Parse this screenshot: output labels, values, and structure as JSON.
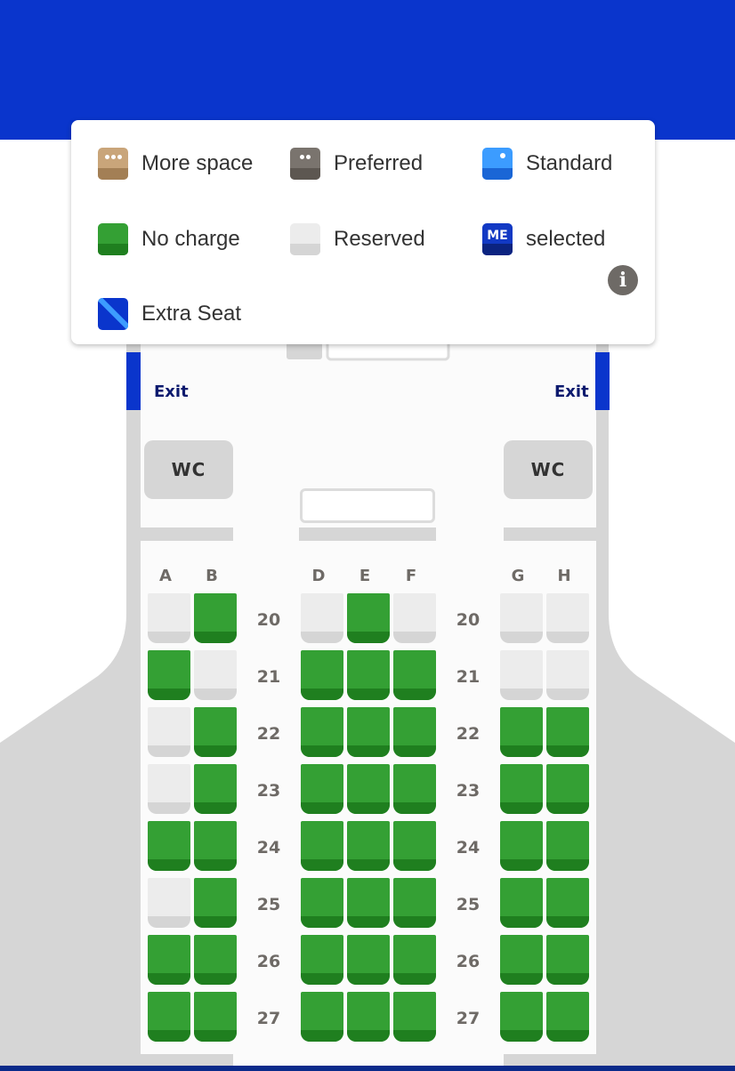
{
  "legend": {
    "more_space": "More space",
    "preferred": "Preferred",
    "standard": "Standard",
    "no_charge": "No charge",
    "reserved": "Reserved",
    "selected": "selected",
    "selected_badge": "ME",
    "extra_seat": "Extra Seat",
    "info_icon": "info-icon"
  },
  "cabin": {
    "exit_left": "Exit",
    "exit_right": "Exit",
    "wc_left": "WC",
    "wc_right": "WC",
    "columns": [
      "A",
      "B",
      "D",
      "E",
      "F",
      "G",
      "H"
    ]
  },
  "colors": {
    "brand_blue": "#0a35cc",
    "no_charge_green": "#34a034",
    "reserved_grey": "#ececec"
  },
  "seat_map": {
    "rows": [
      {
        "row": "20",
        "seats": {
          "A": "reserved",
          "B": "available",
          "D": "reserved",
          "E": "available",
          "F": "reserved",
          "G": "reserved",
          "H": "reserved"
        }
      },
      {
        "row": "21",
        "seats": {
          "A": "available",
          "B": "reserved",
          "D": "available",
          "E": "available",
          "F": "available",
          "G": "reserved",
          "H": "reserved"
        }
      },
      {
        "row": "22",
        "seats": {
          "A": "reserved",
          "B": "available",
          "D": "available",
          "E": "available",
          "F": "available",
          "G": "available",
          "H": "available"
        }
      },
      {
        "row": "23",
        "seats": {
          "A": "reserved",
          "B": "available",
          "D": "available",
          "E": "available",
          "F": "available",
          "G": "available",
          "H": "available"
        }
      },
      {
        "row": "24",
        "seats": {
          "A": "available",
          "B": "available",
          "D": "available",
          "E": "available",
          "F": "available",
          "G": "available",
          "H": "available"
        }
      },
      {
        "row": "25",
        "seats": {
          "A": "reserved",
          "B": "available",
          "D": "available",
          "E": "available",
          "F": "available",
          "G": "available",
          "H": "available"
        }
      },
      {
        "row": "26",
        "seats": {
          "A": "available",
          "B": "available",
          "D": "available",
          "E": "available",
          "F": "available",
          "G": "available",
          "H": "available"
        }
      },
      {
        "row": "27",
        "seats": {
          "A": "available",
          "B": "available",
          "D": "available",
          "E": "available",
          "F": "available",
          "G": "available",
          "H": "available"
        }
      }
    ]
  }
}
